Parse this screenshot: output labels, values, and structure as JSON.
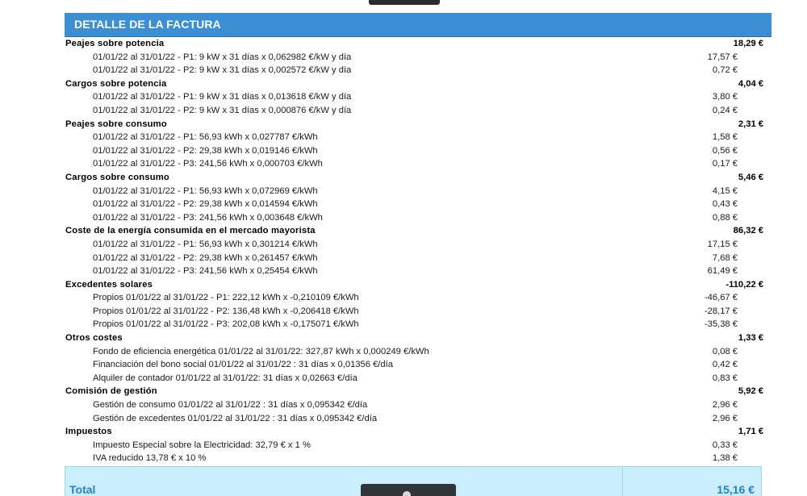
{
  "header": {
    "title": "DETALLE DE LA FACTURA"
  },
  "sections": [
    {
      "title": "Peajes sobre potencia",
      "amount": "18,29 €",
      "items": [
        {
          "desc": "01/01/22 al 31/01/22 - P1: 9 kW x 31 días x 0,062982 €/kW y día",
          "amount": "17,57 €"
        },
        {
          "desc": "01/01/22 al 31/01/22 - P2: 9 kW x 31 días x 0,002572 €/kW y día",
          "amount": "0,72 €"
        }
      ]
    },
    {
      "title": "Cargos sobre potencia",
      "amount": "4,04 €",
      "items": [
        {
          "desc": "01/01/22 al 31/01/22 - P1: 9 kW x 31 días x 0,013618 €/kW y día",
          "amount": "3,80 €"
        },
        {
          "desc": "01/01/22 al 31/01/22 - P2: 9 kW x 31 días x 0,000876 €/kW y día",
          "amount": "0,24 €"
        }
      ]
    },
    {
      "title": "Peajes sobre consumo",
      "amount": "2,31 €",
      "items": [
        {
          "desc": "01/01/22 al 31/01/22 - P1: 56,93 kWh x 0,027787 €/kWh",
          "amount": "1,58 €"
        },
        {
          "desc": "01/01/22 al 31/01/22 - P2: 29,38 kWh x 0,019146 €/kWh",
          "amount": "0,56 €"
        },
        {
          "desc": "01/01/22 al 31/01/22 - P3: 241,56 kWh x 0,000703 €/kWh",
          "amount": "0,17 €"
        }
      ]
    },
    {
      "title": "Cargos sobre consumo",
      "amount": "5,46 €",
      "items": [
        {
          "desc": "01/01/22 al 31/01/22 - P1: 56,93 kWh x 0,072969 €/kWh",
          "amount": "4,15 €"
        },
        {
          "desc": "01/01/22 al 31/01/22 - P2: 29,38 kWh x 0,014594 €/kWh",
          "amount": "0,43 €"
        },
        {
          "desc": "01/01/22 al 31/01/22 - P3: 241,56 kWh x 0,003648 €/kWh",
          "amount": "0,88 €"
        }
      ]
    },
    {
      "title": "Coste de la energía consumida en el mercado mayorista",
      "amount": "86,32 €",
      "items": [
        {
          "desc": "01/01/22 al 31/01/22 - P1: 56,93 kWh x 0,301214 €/kWh",
          "amount": "17,15 €"
        },
        {
          "desc": "01/01/22 al 31/01/22 - P2: 29,38 kWh x 0,261457 €/kWh",
          "amount": "7,68 €"
        },
        {
          "desc": "01/01/22 al 31/01/22 - P3: 241,56 kWh x 0,25454 €/kWh",
          "amount": "61,49 €"
        }
      ]
    },
    {
      "title": "Excedentes solares",
      "amount": "-110,22 €",
      "items": [
        {
          "desc": "Propios 01/01/22 al 31/01/22 - P1: 222,12 kWh x -0,210109 €/kWh",
          "amount": "-46,67 €"
        },
        {
          "desc": "Propios 01/01/22 al 31/01/22 - P2: 136,48 kWh x -0,206418 €/kWh",
          "amount": "-28,17 €"
        },
        {
          "desc": "Propios 01/01/22 al 31/01/22 - P3: 202,08 kWh x -0,175071 €/kWh",
          "amount": "-35,38 €"
        }
      ]
    },
    {
      "title": "Otros costes",
      "amount": "1,33 €",
      "items": [
        {
          "desc": "Fondo de eficiencia energética 01/01/22 al 31/01/22: 327,87 kWh x 0,000249 €/kWh",
          "amount": "0,08 €"
        },
        {
          "desc": "Financiación del bono social 01/01/22 al 31/01/22 : 31 días x 0,01356 €/día",
          "amount": "0,42 €"
        },
        {
          "desc": "Alquiler de contador 01/01/22 al 31/01/22: 31 días x 0,02663 €/día",
          "amount": "0,83 €"
        }
      ]
    },
    {
      "title": "Comisión de gestión",
      "amount": "5,92 €",
      "items": [
        {
          "desc": "Gestión de consumo 01/01/22 al 31/01/22 : 31 días x 0,095342 €/día",
          "amount": "2,96 €"
        },
        {
          "desc": "Gestión de excedentes 01/01/22 al 31/01/22 : 31 días x 0,095342 €/día",
          "amount": "2,96 €"
        }
      ]
    },
    {
      "title": "Impuestos",
      "amount": "1,71 €",
      "items": [
        {
          "desc": "Impuesto Especial sobre la Electricidad: 32,79 € x 1 %",
          "amount": "0,33 €"
        },
        {
          "desc": "IVA reducido 13,78 € x 10 %",
          "amount": "1,38 €"
        }
      ]
    }
  ],
  "total": {
    "label": "Total",
    "amount": "15,16 €"
  }
}
